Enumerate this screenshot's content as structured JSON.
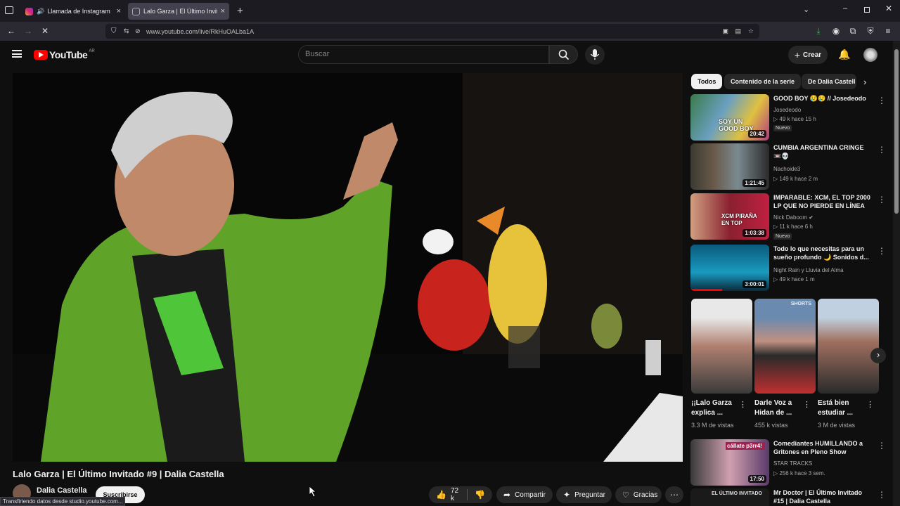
{
  "browser": {
    "tabs": [
      {
        "title": "Llamada de Instagram",
        "close": "×"
      },
      {
        "title": "Lalo Garza | El Último Invitado #",
        "close": "×"
      }
    ],
    "new_tab": "+",
    "url": "www.youtube.com/live/RkHuOALba1A",
    "status": "Transfiriendo datos desde studio.youtube.com..."
  },
  "header": {
    "logo_text": "YouTube",
    "logo_region": "AR",
    "search_placeholder": "Buscar",
    "create_label": "Crear"
  },
  "video": {
    "title": "Lalo Garza | El Último Invitado #9 | Dalia Castella",
    "channel": "Dalia Castella",
    "subscribe_label": "Suscribirse",
    "likes": "72 k",
    "share_label": "Compartir",
    "ask_label": "Preguntar",
    "thanks_label": "Gracias"
  },
  "chips": [
    "Todos",
    "Contenido de la serie",
    "De Dalia Castell"
  ],
  "recommendations": [
    {
      "title": "GOOD BOY 😢😢 // Josedeodo",
      "channel": "Josedeodo",
      "meta": "▷ 49 k  hace 15 h",
      "badge": "Nuevo",
      "duration": "20:42",
      "thumb_text": "SOY UN GOOD BOY"
    },
    {
      "title": "CUMBIA ARGENTINA CRINGE 📼💀",
      "channel": "Nachoide3",
      "meta": "▷ 149 k  hace 2 m",
      "badge": "",
      "duration": "1:21:45",
      "thumb_text": ""
    },
    {
      "title": "IMPARABLE: XCM, EL TOP 2000 LP QUE NO PIERDE EN LÍNEA ...",
      "channel": "Nick Daboom ✔",
      "meta": "▷ 11 k  hace 6 h",
      "badge": "Nuevo",
      "duration": "1:03:38",
      "thumb_text": "XCM PIRAÑA EN TOP"
    },
    {
      "title": "Todo lo que necesitas para un sueño profundo 🌙 Sonidos d...",
      "channel": "Night Rain y Lluvia del Alma",
      "meta": "▷ 49 k  hace 1 m",
      "badge": "",
      "duration": "3:00:01",
      "thumb_text": ""
    }
  ],
  "shorts": [
    {
      "title": "¡¡Lalo Garza explica ...",
      "views": "3.3 M de vistas"
    },
    {
      "title": "Darle Voz a Hidan de ...",
      "views": "455 k vistas"
    },
    {
      "title": "Está bien estudiar ...",
      "views": "3 M de vistas"
    }
  ],
  "more_recommendations": [
    {
      "title": "Comediantes HUMILLANDO a Gritones en Pleno Show",
      "channel": "STAR TRACKS",
      "meta": "▷ 256 k  hace 3 sem.",
      "duration": "17:50",
      "thumb_text": "cállate p3rr4!"
    },
    {
      "title": "Mr Doctor | El Último Invitado #15 | Dalia Castella",
      "channel": "",
      "meta": "",
      "duration": "",
      "thumb_text": "EL ÚLTIMO INVITADO"
    }
  ],
  "colors": {
    "brand_red": "#ff0000",
    "jacket_green": "#5fa428",
    "background": "#0f0f0f"
  }
}
